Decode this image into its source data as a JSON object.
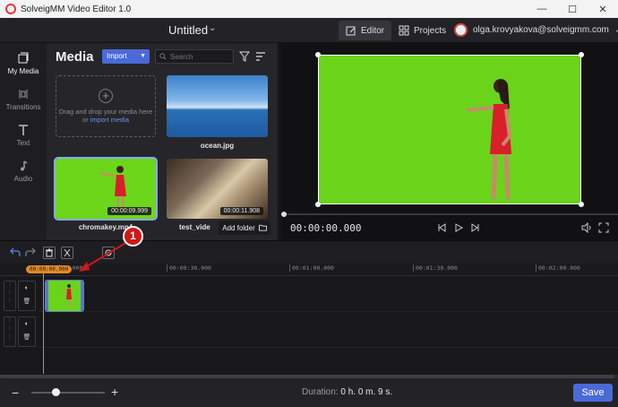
{
  "window": {
    "title": "SolveigMM Video Editor 1.0",
    "controls": [
      "—",
      "☐",
      "✕"
    ]
  },
  "header": {
    "document_title": "Untitled",
    "modes": [
      {
        "label": "Editor",
        "icon": "edit-icon",
        "active": true
      },
      {
        "label": "Projects",
        "icon": "grid-icon",
        "active": false
      }
    ],
    "account_email": "olga.krovyakova@solveigmm.com"
  },
  "sidebar": {
    "items": [
      {
        "label": "My Media",
        "icon": "media-icon",
        "active": true
      },
      {
        "label": "Transitions",
        "icon": "transitions-icon",
        "active": false
      },
      {
        "label": "Text",
        "icon": "text-icon",
        "active": false
      },
      {
        "label": "Audio",
        "icon": "audio-icon",
        "active": false
      }
    ]
  },
  "media": {
    "title": "Media",
    "import_label": "Import",
    "search_placeholder": "Search",
    "dropzone_text": "Drag and drop your media here or",
    "dropzone_link": "import media",
    "items": [
      {
        "name": "ocean.jpg",
        "duration": ""
      },
      {
        "name": "chromakey.mp4",
        "duration": "00:00:09.999"
      },
      {
        "name": "test_vide",
        "duration": "00:00:11.908"
      }
    ],
    "add_folder_label": "Add folder"
  },
  "preview": {
    "timecode": "00:00:00.000"
  },
  "timeline": {
    "playhead_time": "00:00:00.000",
    "ruler_ticks": [
      "00.000",
      "00:00:30.000",
      "00:01:00.000",
      "00:01:30.000",
      "00:02:00.000"
    ],
    "track_grip": [
      "⋮",
      "⋮",
      "⋮"
    ]
  },
  "annotation": {
    "number": "1",
    "color": "#d01818"
  },
  "footer": {
    "zoom_minus": "−",
    "zoom_plus": "+",
    "duration_label": "Duration:",
    "duration_value": "0 h. 0 m. 9 s.",
    "save_label": "Save"
  },
  "colors": {
    "accent": "#4a6ad7",
    "chroma_green": "#6ad41b",
    "playhead": "#e08a2a"
  }
}
